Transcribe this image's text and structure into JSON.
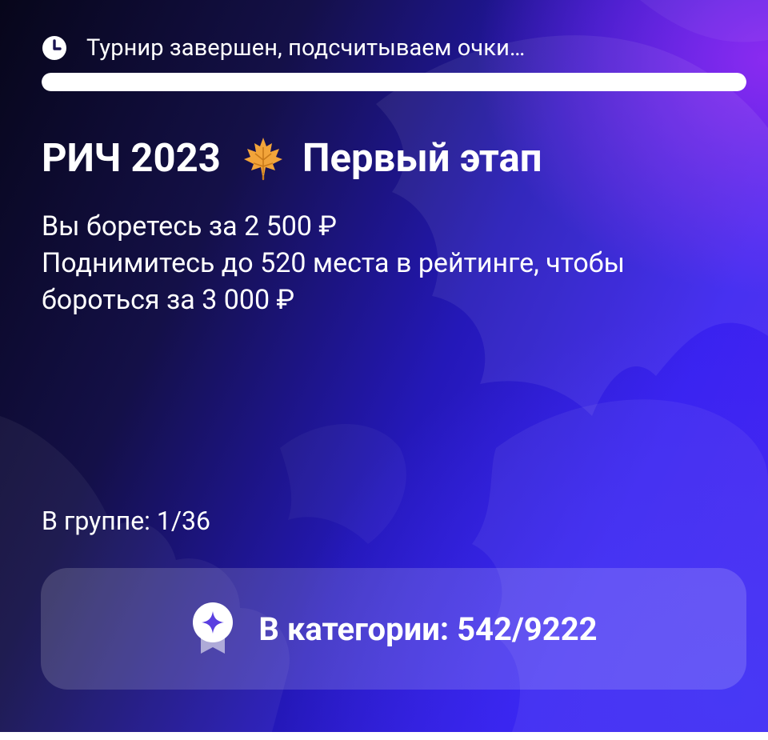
{
  "status": {
    "icon": "clock-icon",
    "text": "Турнир завершен, подсчитываем очки…",
    "progress_fraction": 1.0
  },
  "tournament": {
    "title_prefix": "РИЧ 2023",
    "title_icon": "maple-leaf-icon",
    "title_suffix": "Первый этап"
  },
  "description": {
    "line1": "Вы боретесь за 2 500 ₽",
    "line2": "Поднимитесь до 520 места в рейтинге, чтобы",
    "line3": "бороться за 3 000 ₽"
  },
  "group": {
    "text": "В группе: 1/36"
  },
  "category": {
    "icon": "badge-icon",
    "text": "В категории: 542/9222"
  },
  "colors": {
    "accent": "#4c23f2",
    "dark": "#07061a",
    "text": "#ffffff",
    "leaf": "#f2a43a"
  }
}
